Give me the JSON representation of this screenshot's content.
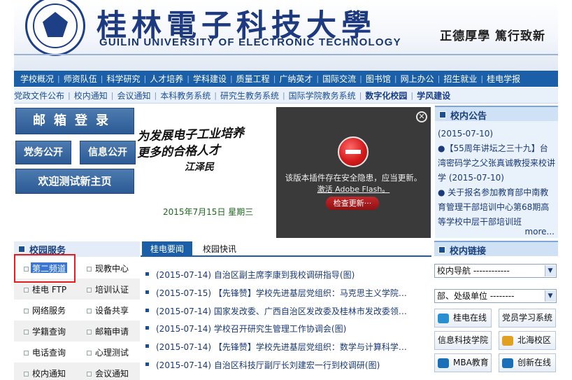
{
  "header": {
    "university_cn": "桂林電子科技大學",
    "university_en": "GUILIN UNIVERSITY OF ELECTRONIC TECHNOLOGY",
    "motto": "正德厚學  篤行致新"
  },
  "nav_main": [
    "学校概况",
    "师资队伍",
    "科学研究",
    "人才培养",
    "学科建设",
    "质量工程",
    "广纳英才",
    "国际交流",
    "图书馆",
    "网上办公",
    "招生就业",
    "桂电学报"
  ],
  "nav_sub": [
    {
      "label": "党政文件公布",
      "bold": false
    },
    {
      "label": "校内通知",
      "bold": false
    },
    {
      "label": "会议通知",
      "bold": false
    },
    {
      "label": "本科教务系统",
      "bold": false
    },
    {
      "label": "研究生教务系统",
      "bold": false
    },
    {
      "label": "国际学院教务系统",
      "bold": false
    },
    {
      "label": "数字化校园",
      "bold": true
    },
    {
      "label": "学风建设",
      "bold": true
    }
  ],
  "buttons": {
    "mail_login": "邮箱登录",
    "party_affairs": "党务公开",
    "info_public": "信息公开",
    "welcome": "欢迎测试新主页"
  },
  "calligraphy": {
    "line1": "为发展电子工业培养",
    "line2": "更多的合格人才",
    "line3": "江泽民"
  },
  "today": "2015年7月15日 星期三",
  "flash": {
    "message": "该版本插件存在安全隐患，应当更新。",
    "link": "激活 Adobe Flash。",
    "button": "检查更新···"
  },
  "notice": {
    "title": "校内公告",
    "items": [
      "(2015-07-10)",
      "●【55周年讲坛之三十九】台湾密码学之父张真诚教授来校讲学 (2015-07-10)",
      "● 关于报名参加教育部中南教育管理干部培训中心第68期高等学校中层干部培训班"
    ],
    "more": "more..."
  },
  "services": {
    "title": "校园服务",
    "items": [
      "第二频道",
      "现教中心",
      "桂电 FTP",
      "培训认证",
      "网络服务",
      "设备共享",
      "学籍查询",
      "邮箱申请",
      "电话查询",
      "心理测试",
      "校内通知",
      "会议通知"
    ]
  },
  "news": {
    "tabs": [
      "桂电要闻",
      "校园快讯"
    ],
    "items": [
      "(2015-07-14) 自治区副主席李康到我校调研指导(图)",
      "(2015-07-15) 【先锋赞】学校先进基层党组织：马克思主义学院…",
      "(2015-07-14) 国家发改委、广西自治区发改委及桂林市发改委领…",
      "(2015-07-14) 学校召开研究生管理工作协调会(图)",
      "(2015-07-14) 【先锋赞】学校先进基层党组织：数学与计算科学…",
      "(2015-07-14) 自治区科技厅副厅长刘建宏一行到校调研(图)"
    ]
  },
  "links": {
    "title": "校内链接",
    "select_nav": "校内导航 ------------",
    "select_dept": "部、处级单位 --------",
    "items": [
      {
        "label": "桂电在线",
        "icon": "globe-icon",
        "color": "#2a8fd0"
      },
      {
        "label": "党员学习系统",
        "icon": "",
        "color": ""
      },
      {
        "label": "信息科技学院",
        "icon": "",
        "color": ""
      },
      {
        "label": "北海校区",
        "icon": "campus-icon",
        "color": "#e0a020"
      },
      {
        "label": "MBA教育",
        "icon": "mba-icon",
        "color": "#1a6fb8"
      },
      {
        "label": "创新在线",
        "icon": "innovation-icon",
        "color": "#1a6fb8"
      }
    ]
  },
  "colors": {
    "nav_main_bg": "#1a5fa8",
    "brand_blue": "#1d3a80",
    "highlight_red": "#e02020"
  }
}
